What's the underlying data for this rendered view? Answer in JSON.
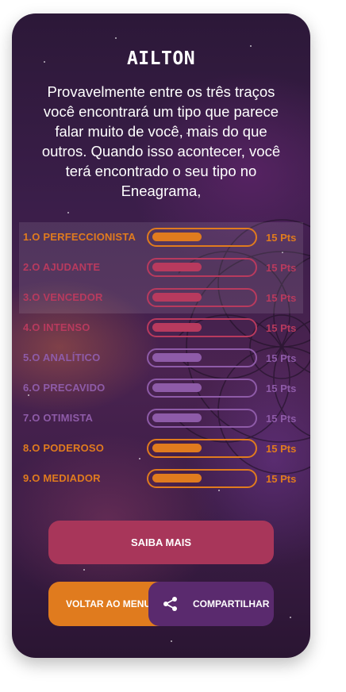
{
  "header": {
    "title": "AILTON",
    "description": "Provavelmente entre os três traços você encontrará um tipo que parece falar muito de você, mais do que outros. Quando isso acontecer, você terá encontrado o seu tipo no Eneagrama,"
  },
  "results": [
    {
      "label": "1.O PERFECCIONISTA",
      "points": "15 Pts",
      "level": 0.5,
      "color": "#e07b1e"
    },
    {
      "label": "2.O AJUDANTE",
      "points": "15 Pts",
      "level": 0.5,
      "color": "#b83a5e"
    },
    {
      "label": "3.O VENCEDOR",
      "points": "15 Pts",
      "level": 0.5,
      "color": "#b83a5e"
    },
    {
      "label": "4.O INTENSO",
      "points": "15 Pts",
      "level": 0.5,
      "color": "#b83a5e"
    },
    {
      "label": "5.O ANALÍTICO",
      "points": "15 Pts",
      "level": 0.5,
      "color": "#8e5ba8"
    },
    {
      "label": "6.O PRECAVIDO",
      "points": "15 Pts",
      "level": 0.5,
      "color": "#8e5ba8"
    },
    {
      "label": "7.O OTIMISTA",
      "points": "15 Pts",
      "level": 0.5,
      "color": "#8e5ba8"
    },
    {
      "label": "8.O PODEROSO",
      "points": "15 Pts",
      "level": 0.5,
      "color": "#e07b1e"
    },
    {
      "label": "9.O MEDIADOR",
      "points": "15 Pts",
      "level": 0.5,
      "color": "#e07b1e"
    }
  ],
  "buttons": {
    "more_label": "SAIBA MAIS",
    "more_color": "#a8365a",
    "back_label": "VOLTAR AO MENU",
    "back_color": "#e07b1e",
    "share_label": "COMPARTILHAR",
    "share_color": "#5a2a6e",
    "share_icon": "share-icon"
  }
}
